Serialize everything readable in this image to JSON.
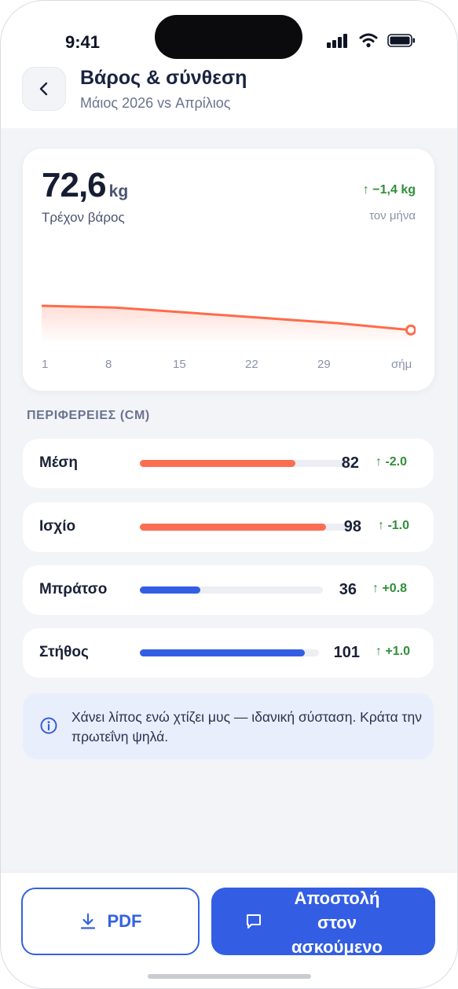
{
  "status_bar": {
    "time": "9:41"
  },
  "header": {
    "title": "Βάρος & σύνθεση",
    "subtitle": "Μάιος 2026 vs Απρίλιος"
  },
  "weight_card": {
    "value": "72,6",
    "unit": "kg",
    "label": "Τρέχον βάρος",
    "delta": "↑ −1,4 kg",
    "period": "τον μήνα"
  },
  "chart_data": {
    "type": "area",
    "x_ticks": [
      "1",
      "8",
      "15",
      "22",
      "29",
      "σήμ"
    ],
    "series": [
      {
        "values": [
          74.0,
          73.9,
          73.6,
          73.3,
          73.0,
          72.6
        ]
      }
    ],
    "line_color": "#ff6b4a",
    "title": "",
    "xlabel": "",
    "ylabel": ""
  },
  "measurements": {
    "section_label": "ΠΕΡΙΦΕΡΕΙΕΣ (CM)",
    "items": [
      {
        "name": "Μέση",
        "value": "82",
        "delta": "↑ -2.0",
        "fill_fraction": 0.75,
        "color": "#fb6e52"
      },
      {
        "name": "Ισχίο",
        "value": "98",
        "delta": "↑ -1.0",
        "fill_fraction": 0.89,
        "color": "#fb6e52"
      },
      {
        "name": "Μπράτσο",
        "value": "36",
        "delta": "↑ +0.8",
        "fill_fraction": 0.33,
        "color": "#335ee3"
      },
      {
        "name": "Στήθος",
        "value": "101",
        "delta": "↑ +1.0",
        "fill_fraction": 0.92,
        "color": "#335ee3"
      }
    ]
  },
  "info": {
    "text": "Χάνει λίπος ενώ χτίζει μυς — ιδανική σύσταση. Κράτα την πρωτεΐνη ψηλά."
  },
  "actions": {
    "pdf_label": "PDF",
    "send_label": "Αποστολή στον ασκούμενο"
  },
  "colors": {
    "accent": "#335ee3",
    "positive": "#2f8f3a",
    "warn": "#fb6e52"
  }
}
